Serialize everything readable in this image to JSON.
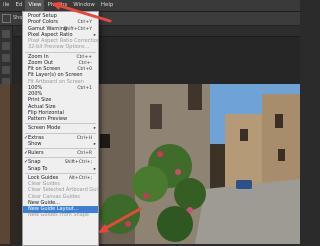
{
  "menubar": [
    "ile",
    "Ed",
    "View",
    "Plugins",
    "Window",
    "Help"
  ],
  "options": {
    "label": "Show Tr"
  },
  "view_menu": [
    {
      "type": "item",
      "label": "Proof Setup",
      "shortcut": "",
      "submenu": true
    },
    {
      "type": "item",
      "label": "Proof Colors",
      "shortcut": "Ctrl+Y"
    },
    {
      "type": "item",
      "label": "Gamut Warning",
      "shortcut": "Shift+Ctrl+Y"
    },
    {
      "type": "item",
      "label": "Pixel Aspect Ratio",
      "shortcut": "",
      "submenu": true
    },
    {
      "type": "item",
      "label": "Pixel Aspect Ratio Correction",
      "disabled": true
    },
    {
      "type": "item",
      "label": "32-bit Preview Options...",
      "disabled": true
    },
    {
      "type": "sep"
    },
    {
      "type": "item",
      "label": "Zoom In",
      "shortcut": "Ctrl++"
    },
    {
      "type": "item",
      "label": "Zoom Out",
      "shortcut": "Ctrl+-"
    },
    {
      "type": "item",
      "label": "Fit on Screen",
      "shortcut": "Ctrl+0"
    },
    {
      "type": "item",
      "label": "Fit Layer(s) on Screen"
    },
    {
      "type": "item",
      "label": "Fit Artboard on Screen",
      "disabled": true
    },
    {
      "type": "item",
      "label": "100%",
      "shortcut": "Ctrl+1"
    },
    {
      "type": "item",
      "label": "200%"
    },
    {
      "type": "item",
      "label": "Print Size"
    },
    {
      "type": "item",
      "label": "Actual Size"
    },
    {
      "type": "item",
      "label": "Flip Horizontal"
    },
    {
      "type": "item",
      "label": "Pattern Preview"
    },
    {
      "type": "sep"
    },
    {
      "type": "item",
      "label": "Screen Mode",
      "submenu": true
    },
    {
      "type": "sep"
    },
    {
      "type": "item",
      "label": "Extras",
      "shortcut": "Ctrl+H",
      "checked": true
    },
    {
      "type": "item",
      "label": "Show",
      "submenu": true
    },
    {
      "type": "sep"
    },
    {
      "type": "item",
      "label": "Rulers",
      "shortcut": "Ctrl+R",
      "checked": true
    },
    {
      "type": "sep"
    },
    {
      "type": "item",
      "label": "Snap",
      "shortcut": "Shift+Ctrl+;",
      "checked": true
    },
    {
      "type": "item",
      "label": "Snap To",
      "submenu": true
    },
    {
      "type": "sep"
    },
    {
      "type": "item",
      "label": "Lock Guides",
      "shortcut": "Alt+Ctrl+;"
    },
    {
      "type": "item",
      "label": "Clear Guides",
      "disabled": true
    },
    {
      "type": "item",
      "label": "Clear Selected Artboard Guides",
      "disabled": true
    },
    {
      "type": "item",
      "label": "Clear Canvas Guides",
      "disabled": true
    },
    {
      "type": "item",
      "label": "New Guide..."
    },
    {
      "type": "item",
      "label": "New Guide Layout...",
      "highlighted": true
    },
    {
      "type": "item",
      "label": "New Guides From Shape",
      "disabled": true
    }
  ]
}
